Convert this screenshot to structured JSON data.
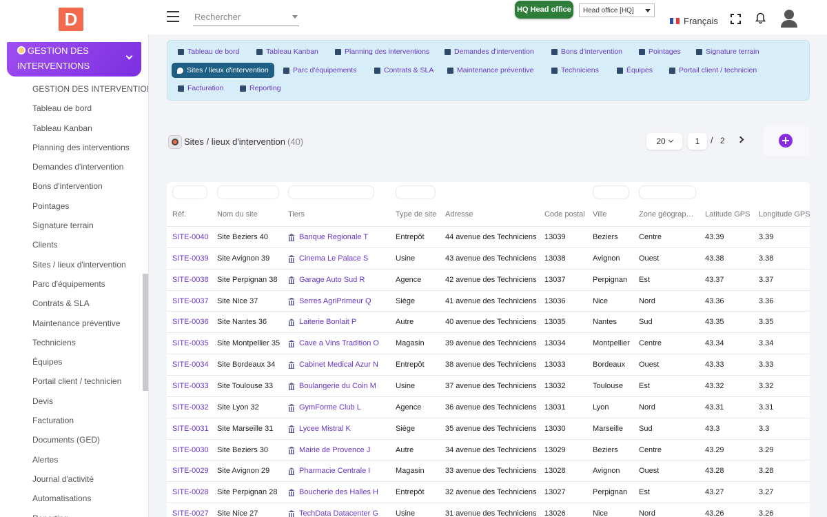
{
  "topbar": {
    "logo_letter": "D",
    "search_placeholder": "Rechercher",
    "hq_badge": "HQ Head office",
    "hq_select": "Head office [HQ]",
    "language": "Français"
  },
  "sidebar": {
    "module_title": "GESTION DES INTERVENTIONS",
    "items": [
      "GESTION DES INTERVENTIONS",
      "Tableau de bord",
      "Tableau Kanban",
      "Planning des interventions",
      "Demandes d'intervention",
      "Bons d'intervention",
      "Pointages",
      "Signature terrain",
      "Clients",
      "Sites / lieux d'intervention",
      "Parc d'équipements",
      "Contrats & SLA",
      "Maintenance préventive",
      "Techniciens",
      "Équipes",
      "Portail client / technicien",
      "Devis",
      "Facturation",
      "Documents (GED)",
      "Alertes",
      "Journal d'activité",
      "Automatisations",
      "Reporting"
    ]
  },
  "tabs": [
    {
      "label": "Tableau de bord",
      "icon": "grid-icon"
    },
    {
      "label": "Tableau Kanban",
      "icon": "kanban-icon"
    },
    {
      "label": "Planning des interventions",
      "icon": "calendar-icon"
    },
    {
      "label": "Demandes d'intervention",
      "icon": "headset-icon"
    },
    {
      "label": "Bons d'intervention",
      "icon": "tools-icon"
    },
    {
      "label": "Pointages",
      "icon": "clock-icon"
    },
    {
      "label": "Signature terrain",
      "icon": "signature-icon"
    },
    {
      "label": "Sites / lieux d'intervention",
      "icon": "map-pin-icon",
      "active": true
    },
    {
      "label": "Parc d'équipements",
      "icon": "cogs-icon"
    },
    {
      "label": "Contrats & SLA",
      "icon": "contract-icon"
    },
    {
      "label": "Maintenance préventive",
      "icon": "calendar-check-icon"
    },
    {
      "label": "Techniciens",
      "icon": "user-cog-icon"
    },
    {
      "label": "Équipes",
      "icon": "users-icon"
    },
    {
      "label": "Portail client / technicien",
      "icon": "mobile-icon"
    },
    {
      "label": "Facturation",
      "icon": "invoice-icon"
    },
    {
      "label": "Reporting",
      "icon": "chart-pie-icon"
    }
  ],
  "page": {
    "title": "Sites / lieux d'intervention",
    "count": "(40)",
    "per_page": "20",
    "current_page": "1",
    "separator": "/",
    "total_pages": "2"
  },
  "table": {
    "headers": [
      "Réf.",
      "Nom du site",
      "Tiers",
      "Type de site",
      "Adresse",
      "Code postal",
      "Ville",
      "Zone géograp…",
      "Latitude GPS",
      "Longitude GPS"
    ],
    "rows": [
      [
        "SITE-0040",
        "Site Beziers 40",
        "Banque Regionale T",
        "Entrepôt",
        "44 avenue des Techniciens",
        "13039",
        "Beziers",
        "Centre",
        "43.39",
        "3.39"
      ],
      [
        "SITE-0039",
        "Site Avignon 39",
        "Cinema Le Palace S",
        "Usine",
        "43 avenue des Techniciens",
        "13038",
        "Avignon",
        "Ouest",
        "43.38",
        "3.38"
      ],
      [
        "SITE-0038",
        "Site Perpignan 38",
        "Garage Auto Sud R",
        "Agence",
        "42 avenue des Techniciens",
        "13037",
        "Perpignan",
        "Est",
        "43.37",
        "3.37"
      ],
      [
        "SITE-0037",
        "Site Nice 37",
        "Serres AgriPrimeur Q",
        "Siège",
        "41 avenue des Techniciens",
        "13036",
        "Nice",
        "Nord",
        "43.36",
        "3.36"
      ],
      [
        "SITE-0036",
        "Site Nantes 36",
        "Laiterie Bonlait P",
        "Autre",
        "40 avenue des Techniciens",
        "13035",
        "Nantes",
        "Sud",
        "43.35",
        "3.35"
      ],
      [
        "SITE-0035",
        "Site Montpellier 35",
        "Cave a Vins Tradition O",
        "Magasin",
        "39 avenue des Techniciens",
        "13034",
        "Montpellier",
        "Centre",
        "43.34",
        "3.34"
      ],
      [
        "SITE-0034",
        "Site Bordeaux 34",
        "Cabinet Medical Azur N",
        "Entrepôt",
        "38 avenue des Techniciens",
        "13033",
        "Bordeaux",
        "Ouest",
        "43.33",
        "3.33"
      ],
      [
        "SITE-0033",
        "Site Toulouse 33",
        "Boulangerie du Coin M",
        "Usine",
        "37 avenue des Techniciens",
        "13032",
        "Toulouse",
        "Est",
        "43.32",
        "3.32"
      ],
      [
        "SITE-0032",
        "Site Lyon 32",
        "GymForme Club L",
        "Agence",
        "36 avenue des Techniciens",
        "13031",
        "Lyon",
        "Nord",
        "43.31",
        "3.31"
      ],
      [
        "SITE-0031",
        "Site Marseille 31",
        "Lycee Mistral K",
        "Siège",
        "35 avenue des Techniciens",
        "13030",
        "Marseille",
        "Sud",
        "43.3",
        "3.3"
      ],
      [
        "SITE-0030",
        "Site Beziers 30",
        "Mairie de Provence J",
        "Autre",
        "34 avenue des Techniciens",
        "13029",
        "Beziers",
        "Centre",
        "43.29",
        "3.29"
      ],
      [
        "SITE-0029",
        "Site Avignon 29",
        "Pharmacie Centrale I",
        "Magasin",
        "33 avenue des Techniciens",
        "13028",
        "Avignon",
        "Ouest",
        "43.28",
        "3.28"
      ],
      [
        "SITE-0028",
        "Site Perpignan 28",
        "Boucherie des Halles H",
        "Entrepôt",
        "32 avenue des Techniciens",
        "13027",
        "Perpignan",
        "Est",
        "43.27",
        "3.27"
      ],
      [
        "SITE-0027",
        "Site Nice 27",
        "TechData Datacenter G",
        "Usine",
        "31 avenue des Techniciens",
        "13026",
        "Nice",
        "Nord",
        "43.26",
        "3.26"
      ]
    ]
  },
  "colors": {
    "accent": "#6a35c8",
    "module_gradient_start": "#9f4ef0",
    "active_tab": "#1e5f86",
    "hq_badge": "#2f7d3a",
    "logo": "#f26a4b",
    "tabs_panel": "#d7eef8"
  }
}
